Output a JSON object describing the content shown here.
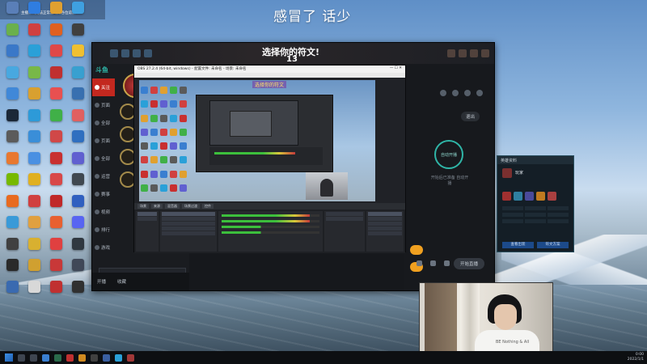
{
  "overlay": {
    "caption": "感冒了 话少"
  },
  "desktop": {
    "top_strip_text": "主播录制无法正常游戏请各位谅解",
    "icons": [
      {
        "name": "recycle-bin-icon",
        "label": "",
        "color": "#5a7fb8"
      },
      {
        "name": "app-icon",
        "label": "",
        "color": "#2f7de0"
      },
      {
        "name": "app-icon",
        "label": "",
        "color": "#e0a030"
      },
      {
        "name": "app-icon",
        "label": "",
        "color": "#3fa0e0"
      },
      {
        "name": "app-icon",
        "label": "",
        "color": "#6ab04c"
      },
      {
        "name": "app-icon",
        "label": "",
        "color": "#d04040"
      },
      {
        "name": "app-icon",
        "label": "",
        "color": "#e06020"
      },
      {
        "name": "app-icon",
        "label": "",
        "color": "#404040"
      },
      {
        "name": "app-icon",
        "label": "",
        "color": "#3a78c8"
      },
      {
        "name": "app-icon",
        "label": "",
        "color": "#2aa0d8"
      },
      {
        "name": "app-icon",
        "label": "",
        "color": "#e04848"
      },
      {
        "name": "app-icon",
        "label": "",
        "color": "#f0c030"
      },
      {
        "name": "app-icon",
        "label": "",
        "color": "#48a8e0"
      },
      {
        "name": "app-icon",
        "label": "",
        "color": "#78b848"
      },
      {
        "name": "app-icon",
        "label": "",
        "color": "#c03030"
      },
      {
        "name": "app-icon",
        "label": "",
        "color": "#38a0d0"
      },
      {
        "name": "app-icon",
        "label": "",
        "color": "#4088d8"
      },
      {
        "name": "app-icon",
        "label": "",
        "color": "#d8a030"
      },
      {
        "name": "app-icon",
        "label": "",
        "color": "#e85050"
      },
      {
        "name": "app-icon",
        "label": "",
        "color": "#3870b0"
      },
      {
        "name": "steam-icon",
        "label": "",
        "color": "#1b2838"
      },
      {
        "name": "app-icon",
        "label": "",
        "color": "#2d9ad8"
      },
      {
        "name": "app-icon",
        "label": "",
        "color": "#40b048"
      },
      {
        "name": "app-icon",
        "label": "",
        "color": "#e06060"
      },
      {
        "name": "app-icon",
        "label": "",
        "color": "#5b5b5b"
      },
      {
        "name": "app-icon",
        "label": "",
        "color": "#3a8ed8"
      },
      {
        "name": "app-icon",
        "label": "",
        "color": "#d04848"
      },
      {
        "name": "app-icon",
        "label": "",
        "color": "#2f6fc0"
      },
      {
        "name": "app-icon",
        "label": "",
        "color": "#e87830"
      },
      {
        "name": "app-icon",
        "label": "",
        "color": "#4a90e2"
      },
      {
        "name": "app-icon",
        "label": "",
        "color": "#c83030"
      },
      {
        "name": "app-icon",
        "label": "",
        "color": "#6060d0"
      },
      {
        "name": "nvidia-icon",
        "label": "",
        "color": "#76b900"
      },
      {
        "name": "app-icon",
        "label": "",
        "color": "#e0b020"
      },
      {
        "name": "app-icon",
        "label": "",
        "color": "#d84848"
      },
      {
        "name": "app-icon",
        "label": "",
        "color": "#404850"
      },
      {
        "name": "app-icon",
        "label": "",
        "color": "#e86a20"
      },
      {
        "name": "app-icon",
        "label": "",
        "color": "#d04040"
      },
      {
        "name": "app-icon",
        "label": "",
        "color": "#c02828"
      },
      {
        "name": "app-icon",
        "label": "",
        "color": "#3060c0"
      },
      {
        "name": "app-icon",
        "label": "",
        "color": "#3a9ad8"
      },
      {
        "name": "app-icon",
        "label": "",
        "color": "#e0a040"
      },
      {
        "name": "app-icon",
        "label": "",
        "color": "#e86030"
      },
      {
        "name": "app-icon",
        "label": "",
        "color": "#5865f2"
      },
      {
        "name": "app-icon",
        "label": "",
        "color": "#404040"
      },
      {
        "name": "app-icon",
        "label": "",
        "color": "#d8b030"
      },
      {
        "name": "app-icon",
        "label": "",
        "color": "#e04040"
      },
      {
        "name": "app-icon",
        "label": "",
        "color": "#303840"
      },
      {
        "name": "app-icon",
        "label": "",
        "color": "#2a2a2a"
      },
      {
        "name": "app-icon",
        "label": "",
        "color": "#d0a030"
      },
      {
        "name": "app-icon",
        "label": "",
        "color": "#c83838"
      },
      {
        "name": "app-icon",
        "label": "",
        "color": "#404858"
      },
      {
        "name": "app-icon",
        "label": "",
        "color": "#3a6ab0"
      },
      {
        "name": "app-icon",
        "label": "",
        "color": "#d8d8d8"
      },
      {
        "name": "app-icon",
        "label": "",
        "color": "#c03030"
      },
      {
        "name": "app-icon",
        "label": "",
        "color": "#303030"
      }
    ]
  },
  "client": {
    "title": "选择你的符文!",
    "countdown": "13",
    "brand_prefix": "",
    "nav": [
      "关注",
      "页面",
      "全部",
      "页面",
      "全部",
      "运营",
      "赛事",
      "视频",
      "排行",
      "游戏"
    ],
    "bottom_nav": [
      "开播",
      "收藏"
    ],
    "right": {
      "exit": "退出",
      "auto": "自动开播",
      "auto_note": "开始后已准备 自动开播",
      "start": "开始直播"
    }
  },
  "stats_panel": {
    "title": "英雄资料",
    "name": "玩家",
    "buttons": [
      "查看出装",
      "符文方案"
    ]
  },
  "vm": {
    "title": "OBS 27.2.4 (64-bit, windows) - 配置文件: 未命名 - 场景: 未命名",
    "caption": "选择你的符文",
    "obs_tabs": [
      "场景",
      "来源",
      "混音器",
      "场景过渡",
      "控件"
    ]
  },
  "webcam": {
    "shirt_text": "BE Nothing & All"
  },
  "taskbar": {
    "time": "0:00",
    "date": "2022/1/1"
  },
  "colors": {
    "accent_red": "#c3281f",
    "accent_teal": "#2fb5a7",
    "accent_orange": "#f0a020"
  }
}
